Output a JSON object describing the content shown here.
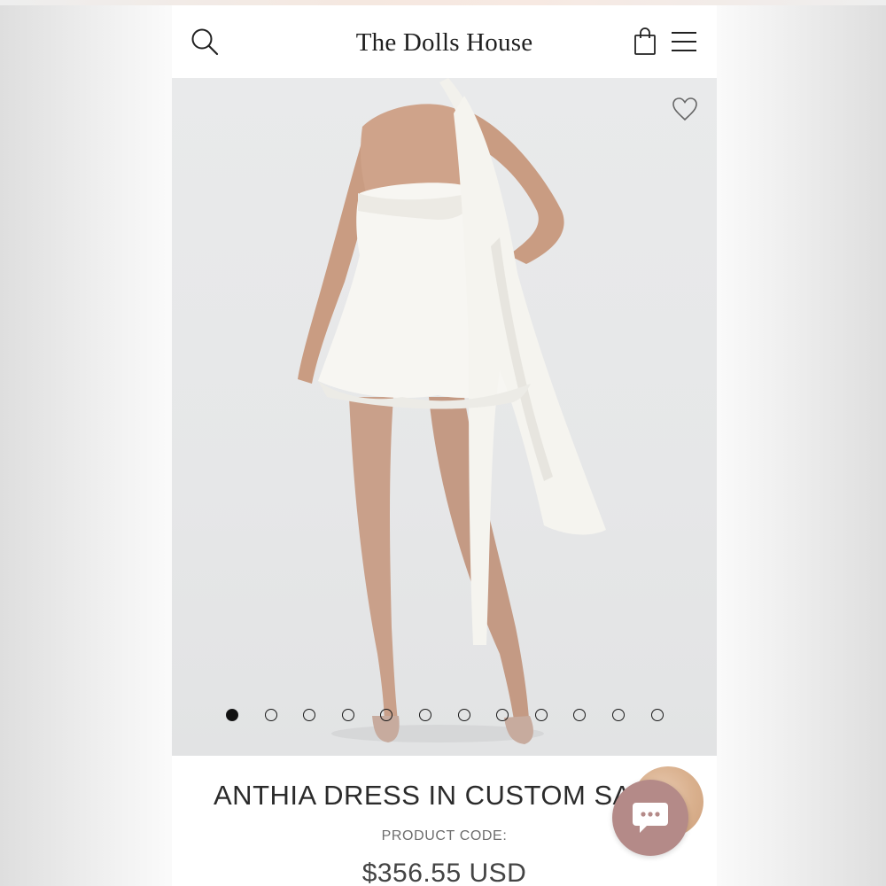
{
  "header": {
    "brand": "The Dolls House",
    "search_icon": "search-icon",
    "cart_icon": "shopping-bag-icon",
    "menu_icon": "hamburger-menu-icon"
  },
  "hero": {
    "wishlist_icon": "heart-icon",
    "carousel": {
      "total": 12,
      "active_index": 0
    }
  },
  "product": {
    "title": "ANTHIA DRESS IN CUSTOM SATIN",
    "code_label": "PRODUCT CODE:",
    "price": "$356.55 USD"
  },
  "chat": {
    "icon": "chat-bubble-icon"
  },
  "colors": {
    "chat_button": "#b48a88",
    "accent_peach": "#d9b08d",
    "text_dark": "#2b2b2b"
  }
}
